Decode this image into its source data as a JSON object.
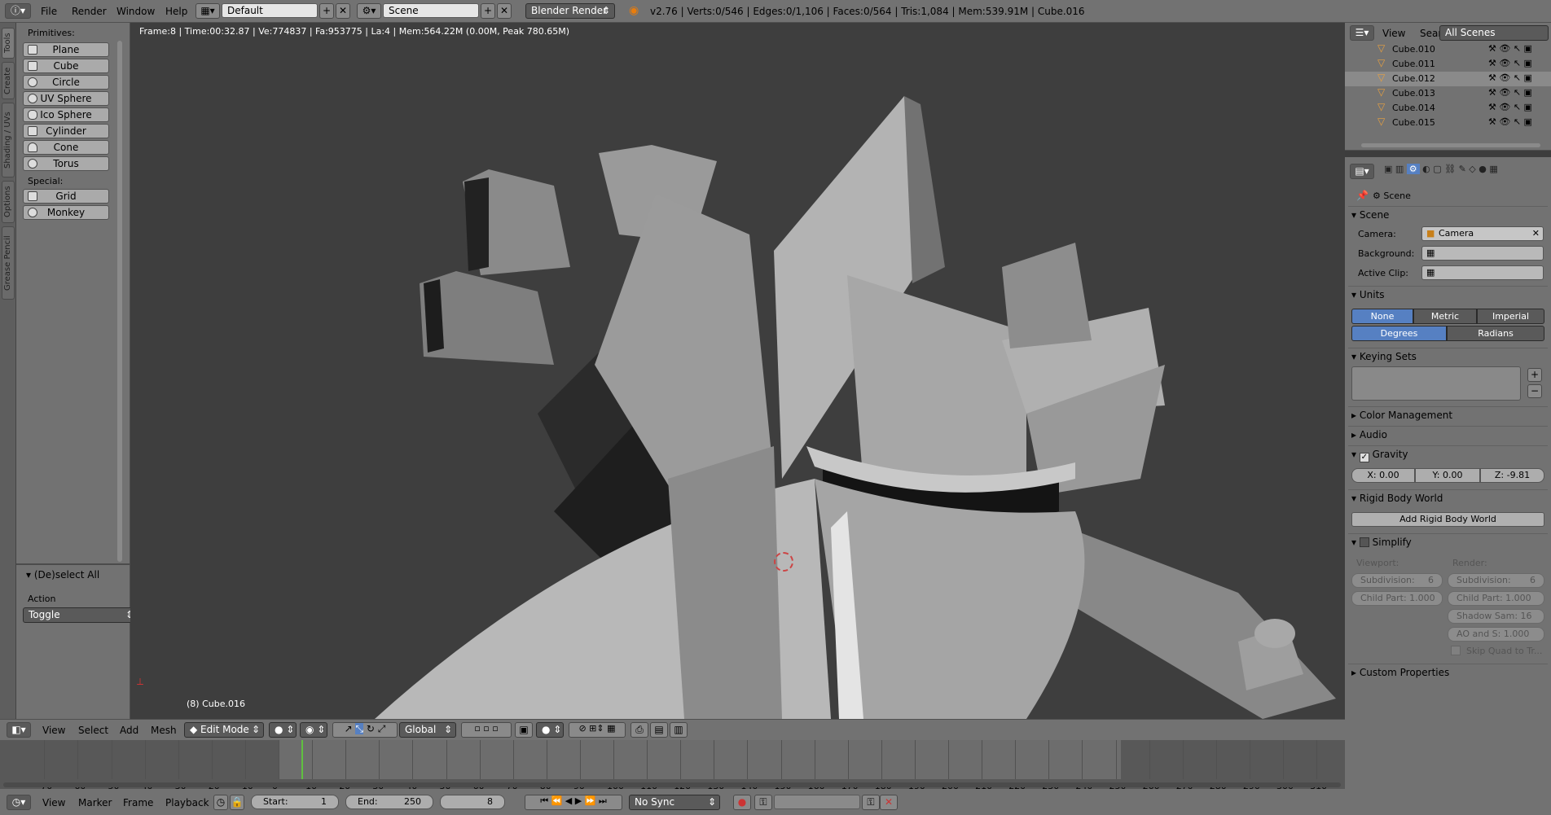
{
  "topbar": {
    "menus": [
      "File",
      "Render",
      "Window",
      "Help"
    ],
    "screen_layout": "Default",
    "scene_name": "Scene",
    "render_engine": "Blender Render",
    "stats": "v2.76 | Verts:0/546 | Edges:0/1,106 | Faces:0/564 | Tris:1,084 | Mem:539.91M | Cube.016"
  },
  "tabs": [
    "Tools",
    "Create",
    "Shading / UVs",
    "Options",
    "Grease Pencil"
  ],
  "toolshelf": {
    "primitives_header": "Primitives:",
    "primitives": [
      "Plane",
      "Cube",
      "Circle",
      "UV Sphere",
      "Ico Sphere",
      "Cylinder",
      "Cone",
      "Torus"
    ],
    "special_header": "Special:",
    "special": [
      "Grid",
      "Monkey"
    ],
    "operator_title": "(De)select All",
    "action_label": "Action",
    "action_value": "Toggle"
  },
  "viewport": {
    "info": "Frame:8 | Time:00:32.87 | Ve:774837 | Fa:953775 | La:4 | Mem:564.22M (0.00M, Peak 780.65M)",
    "object_label": "(8) Cube.016"
  },
  "outliner": {
    "menus": [
      "View",
      "Search"
    ],
    "filter": "All Scenes",
    "objects": [
      "Cube.010",
      "Cube.011",
      "Cube.012",
      "Cube.013",
      "Cube.014",
      "Cube.015"
    ]
  },
  "properties": {
    "breadcrumb": "Scene",
    "scene_panel": "Scene",
    "camera_label": "Camera:",
    "camera_value": "Camera",
    "background_label": "Background:",
    "active_clip_label": "Active Clip:",
    "units_panel": "Units",
    "unit_systems": [
      "None",
      "Metric",
      "Imperial"
    ],
    "rotation_units": [
      "Degrees",
      "Radians"
    ],
    "keying_sets_panel": "Keying Sets",
    "color_management_panel": "Color Management",
    "audio_panel": "Audio",
    "gravity_panel": "Gravity",
    "gravity_x": "X:",
    "gravity_x_value": "0.00",
    "gravity_y": "Y:",
    "gravity_y_value": "0.00",
    "gravity_z": "Z:",
    "gravity_z_value": "-9.81",
    "rigid_body_panel": "Rigid Body World",
    "add_rigid_body": "Add Rigid Body World",
    "simplify_panel": "Simplify",
    "viewport_label": "Viewport:",
    "render_label": "Render:",
    "vp_subdivision": "Subdivision:",
    "vp_subdivision_value": "6",
    "vp_child_part": "Child Part: 1.000",
    "r_subdivision": "Subdivision:",
    "r_subdivision_value": "6",
    "r_child_part": "Child Part: 1.000",
    "r_shadow": "Shadow Sam: 16",
    "r_ao": "AO and S: 1.000",
    "skip_quad": "Skip Quad to Tr...",
    "custom_properties_panel": "Custom Properties"
  },
  "viewport_header": {
    "menus": [
      "View",
      "Select",
      "Add",
      "Mesh"
    ],
    "mode": "Edit Mode",
    "orientation": "Global"
  },
  "timeline": {
    "ticks": [
      "-70",
      "-60",
      "-50",
      "-40",
      "-30",
      "-20",
      "-10",
      "0",
      "10",
      "20",
      "30",
      "40",
      "50",
      "60",
      "70",
      "80",
      "90",
      "100",
      "110",
      "120",
      "130",
      "140",
      "150",
      "160",
      "170",
      "180",
      "190",
      "200",
      "210",
      "220",
      "230",
      "240",
      "250",
      "260",
      "270",
      "280",
      "290",
      "300",
      "310"
    ],
    "current_frame_label": "8",
    "menus": [
      "View",
      "Marker",
      "Frame",
      "Playback"
    ],
    "start_label": "Start:",
    "start_value": "1",
    "end_label": "End:",
    "end_value": "250",
    "current": "8",
    "sync": "No Sync"
  },
  "colors": {
    "accent_blue": "#5680c2",
    "panel_gray": "#727272",
    "viewport_bg": "#3e3e3e"
  }
}
